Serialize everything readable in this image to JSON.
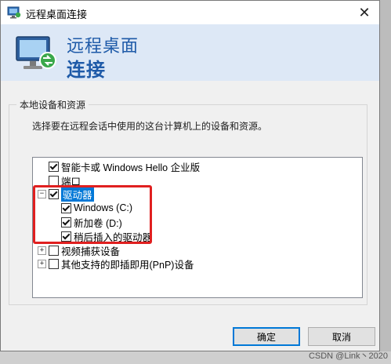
{
  "window": {
    "title": "远程桌面连接",
    "close_glyph": "✕"
  },
  "header": {
    "line1": "远程桌面",
    "line2": "连接"
  },
  "group": {
    "label": "本地设备和资源",
    "description": "选择要在远程会话中使用的这台计算机上的设备和资源。"
  },
  "tree": {
    "items": [
      {
        "label": "智能卡或 Windows Hello 企业版",
        "checked": true
      },
      {
        "label": "端口",
        "checked": false
      },
      {
        "label": "驱动器",
        "checked": true,
        "expander": "−",
        "selected": true
      },
      {
        "label": "Windows (C:)",
        "checked": true
      },
      {
        "label": "新加卷 (D:)",
        "checked": true
      },
      {
        "label": "稍后插入的驱动器",
        "checked": true
      },
      {
        "label": "视频捕获设备",
        "checked": false,
        "expander": "+"
      },
      {
        "label": "其他支持的即插即用(PnP)设备",
        "checked": false,
        "expander": "+"
      }
    ]
  },
  "buttons": {
    "ok": "确定",
    "cancel": "取消"
  },
  "watermark": "CSDN @Link丶2020",
  "colors": {
    "accent": "#1e5aa8",
    "header_bg": "#dde8f6",
    "selection": "#0078d7",
    "highlight_box": "#e02020"
  }
}
